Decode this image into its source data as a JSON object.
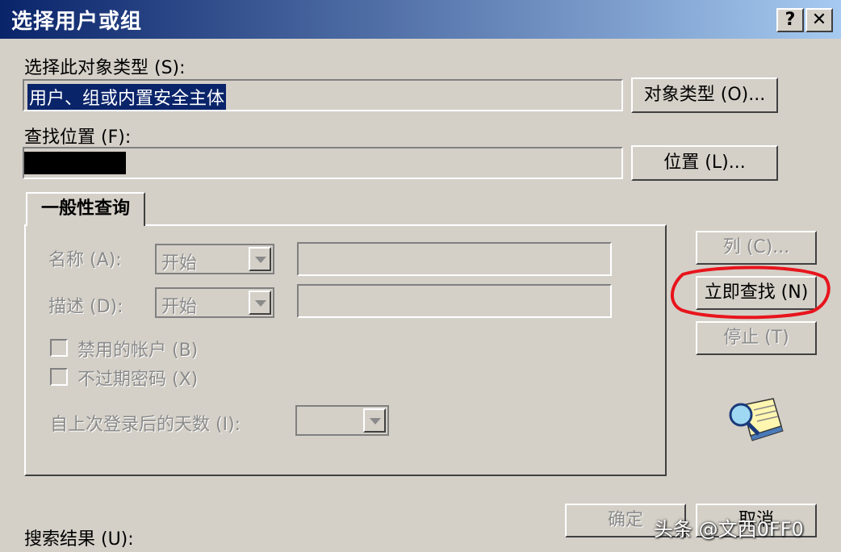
{
  "window": {
    "title": "选择用户或组",
    "help_label": "?",
    "close_label": "✕"
  },
  "object_type": {
    "label": "选择此对象类型 (S):",
    "value": "用户、组或内置安全主体",
    "button": "对象类型 (O)..."
  },
  "location": {
    "label": "查找位置 (F):",
    "value": "",
    "button": "位置 (L)..."
  },
  "tab": {
    "label": "一般性查询"
  },
  "query": {
    "name_label": "名称 (A):",
    "name_mode": "开始",
    "name_value": "",
    "desc_label": "描述 (D):",
    "desc_mode": "开始",
    "desc_value": "",
    "disabled_accounts": "禁用的帐户 (B)",
    "non_expiring_password": "不过期密码 (X)",
    "days_since_logon_label": "自上次登录后的天数 (I):",
    "days_since_logon_value": ""
  },
  "side_buttons": {
    "columns": "列 (C)...",
    "find_now": "立即查找 (N)",
    "stop": "停止 (T)"
  },
  "bottom": {
    "ok": "确定",
    "cancel": "取消",
    "results_label": "搜索结果 (U):"
  },
  "watermark": "头条 @文西0FF0",
  "colors": {
    "title_start": "#0a246a",
    "title_end": "#a6caf0",
    "face": "#d4d0c8",
    "highlight_ring": "#e8141c"
  },
  "icons": {
    "search_icon": "magnifier-over-list-icon"
  }
}
